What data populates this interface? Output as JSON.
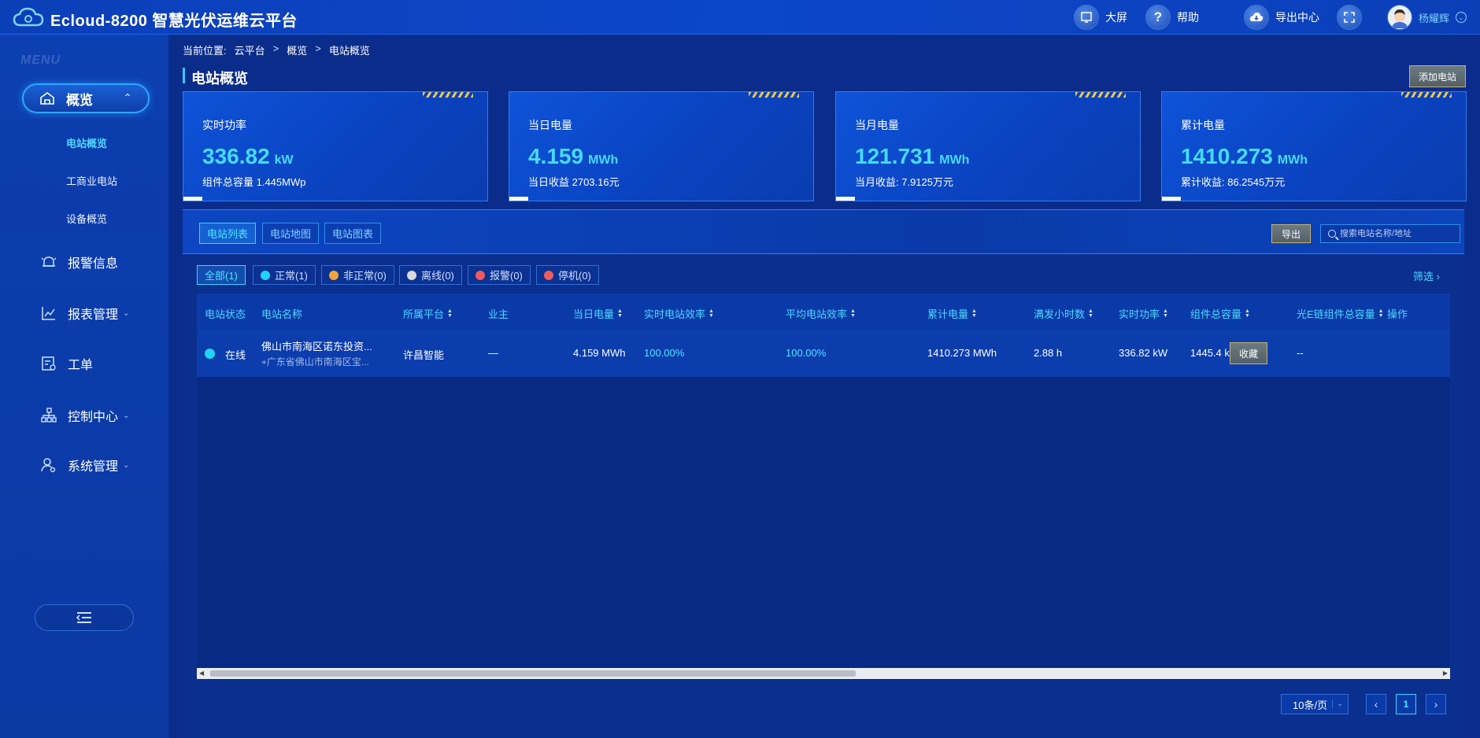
{
  "app": {
    "title": "Ecloud-8200 智慧光伏运维云平台"
  },
  "header": {
    "actions": [
      {
        "label": "大屏",
        "icon": "big-screen-icon"
      },
      {
        "label": "帮助",
        "icon": "help-icon"
      },
      {
        "label": "导出中心",
        "icon": "cloud-download-icon"
      },
      {
        "label": "",
        "icon": "fullscreen-icon"
      }
    ],
    "user": {
      "name": "杨耀辉",
      "icon": "avatar"
    }
  },
  "sidebar": {
    "watermark": "MENU",
    "overview": {
      "label": "概览",
      "icon": "home-icon"
    },
    "submenu": [
      "电站概览",
      "工商业电站",
      "设备概览"
    ],
    "active_sub": 0,
    "items": [
      {
        "label": "报警信息",
        "icon": "alarm-bell-icon",
        "dropdown": false
      },
      {
        "label": "报表管理",
        "icon": "report-chart-icon",
        "dropdown": true
      },
      {
        "label": "工单",
        "icon": "work-order-icon",
        "dropdown": false
      },
      {
        "label": "控制中心",
        "icon": "org-tree-icon",
        "dropdown": true
      },
      {
        "label": "系统管理",
        "icon": "user-settings-icon",
        "dropdown": true
      }
    ]
  },
  "breadcrumb": {
    "prefix": "当前位置:",
    "items": [
      "云平台",
      "概览",
      "电站概览"
    ]
  },
  "page": {
    "title": "电站概览",
    "add_button": "添加电站"
  },
  "stats": [
    {
      "label": "实时功率",
      "value": "336.82",
      "unit": "kW",
      "sub": "组件总容量 1.445MWp"
    },
    {
      "label": "当日电量",
      "value": "4.159",
      "unit": "MWh",
      "sub": "当日收益 2703.16元"
    },
    {
      "label": "当月电量",
      "value": "121.731",
      "unit": "MWh",
      "sub": "当月收益: 7.9125万元"
    },
    {
      "label": "累计电量",
      "value": "1410.273",
      "unit": "MWh",
      "sub": "累计收益: 86.2545万元"
    }
  ],
  "tabs": [
    "电站列表",
    "电站地图",
    "电站图表"
  ],
  "active_tab": 0,
  "toolbar": {
    "export_label": "导出",
    "search_placeholder": "搜索电站名称/地址"
  },
  "filters": [
    {
      "label": "全部(1)",
      "color": ""
    },
    {
      "label": "正常(1)",
      "color": "#1fd4f5"
    },
    {
      "label": "非正常(0)",
      "color": "#f0a63a"
    },
    {
      "label": "离线(0)",
      "color": "#d9d9d9"
    },
    {
      "label": "报警(0)",
      "color": "#f05a5a"
    },
    {
      "label": "停机(0)",
      "color": "#f05a5a"
    }
  ],
  "screen_label": "筛选",
  "table": {
    "columns": [
      "电站状态",
      "电站名称",
      "所属平台",
      "业主",
      "当日电量",
      "实时电站效率",
      "平均电站效率",
      "累计电量",
      "满发小时数",
      "实时功率",
      "组件总容量",
      "光E链组件总容量",
      "操作"
    ],
    "rows": [
      {
        "status": "在线",
        "status_color": "#1fd4f5",
        "name": "佛山市南海区诺东投资...",
        "address": "广东省佛山市南海区宝...",
        "platform": "许昌智能",
        "owner": "—",
        "day_energy": "4.159 MWh",
        "rt_eff": "100.00%",
        "avg_eff": "100.00%",
        "total_energy": "1410.273 MWh",
        "full_hours": "2.88 h",
        "rt_power": "336.82 kW",
        "capacity": "1445.4 kWp",
        "e_capacity": "--",
        "action": "收藏"
      }
    ]
  },
  "pagination": {
    "page_size": "10条/页",
    "current": "1"
  }
}
